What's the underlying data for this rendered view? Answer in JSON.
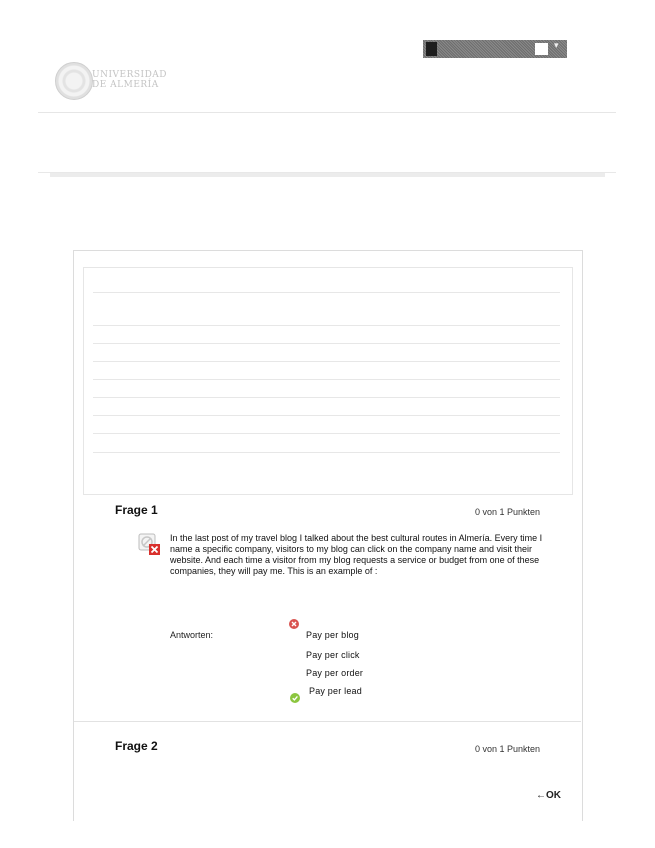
{
  "header": {
    "logo_text": [
      "UNIVERSIDAD",
      "DE ALMERÍA"
    ],
    "user_menu": {
      "caret": "▾"
    }
  },
  "quiz": {
    "questions": [
      {
        "title": "Frage 1",
        "points": "0 von 1 Punkten",
        "text": "In the last post of my travel blog I talked about the best cultural routes in Almería. Every time I name a specific company, visitors to my blog can click on the company name and visit their website. And each time a visitor from my blog requests a service or budget from one of these companies, they will pay me. This is an example of :",
        "answers_label": "Antworten:",
        "answers": [
          {
            "label": "Pay per blog",
            "status": "wrong"
          },
          {
            "label": "Pay per click",
            "status": "none"
          },
          {
            "label": "Pay per order",
            "status": "none"
          },
          {
            "label": "Pay per lead",
            "status": "correct"
          }
        ]
      },
      {
        "title": "Frage 2",
        "points": "0 von 1 Punkten"
      }
    ]
  },
  "footer": {
    "ok_label": "←OK"
  },
  "colors": {
    "wrong": "#d9534f",
    "correct": "#8cc63f"
  }
}
